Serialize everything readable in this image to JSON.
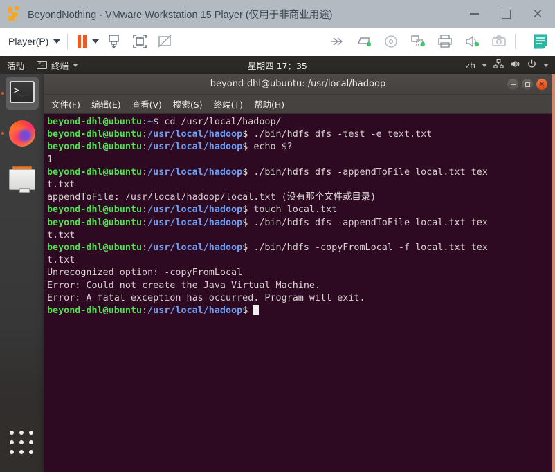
{
  "vmware": {
    "title": "BeyondNothing - VMware Workstation 15 Player (仅用于非商业用途)",
    "logo_icon": "vmware-logo-icon",
    "window_buttons": {
      "minimize": "minimize-icon",
      "maximize": "maximize-icon",
      "close": "close-icon"
    },
    "toolbar": {
      "player_menu_label": "Player(P)",
      "player_caret_icon": "chevron-down-icon",
      "pause_icon": "pause-icon",
      "pause_caret_icon": "chevron-down-icon",
      "unity_icon": "send-to-back-icon",
      "fullscreen_icon": "fullscreen-icon",
      "stretch_icon": "stretch-disabled-icon",
      "right_icons": [
        "network-fast-forward-icon",
        "removable-disk-icon",
        "cd-dvd-icon",
        "network-adapter-icon",
        "printer-icon",
        "sound-icon",
        "camera-icon",
        "notes-icon"
      ]
    }
  },
  "ubuntu_panel": {
    "activities": "活动",
    "app_name": "终端",
    "app_icon": "terminal-icon",
    "app_caret_icon": "chevron-down-icon",
    "clock": "星期四 17：35",
    "language": "zh",
    "language_caret_icon": "chevron-down-icon",
    "network_icon": "network-wired-icon",
    "volume_icon": "volume-icon",
    "power_icon": "power-icon",
    "system_caret_icon": "chevron-down-icon"
  },
  "dock": {
    "items": [
      {
        "name": "terminal",
        "icon": "terminal-icon",
        "running": true,
        "active": true
      },
      {
        "name": "firefox",
        "icon": "firefox-icon",
        "running": true,
        "active": false
      },
      {
        "name": "files",
        "icon": "file-manager-icon",
        "running": false,
        "active": false
      }
    ],
    "show_applications_icon": "apps-grid-icon"
  },
  "terminal": {
    "title": "beyond-dhl@ubuntu: /usr/local/hadoop",
    "window_buttons": {
      "minimize": "minimize-icon",
      "maximize": "maximize-icon",
      "close": "close-icon"
    },
    "menu": [
      "文件(F)",
      "编辑(E)",
      "查看(V)",
      "搜索(S)",
      "终端(T)",
      "帮助(H)"
    ],
    "colors": {
      "background": "#2d0922",
      "foreground": "#d7d2d0",
      "user_host": "#4ee24e",
      "path": "#6a9ef5",
      "window_accent": "#d98666",
      "close_button": "#dd4814"
    },
    "prompt": {
      "user_host": "beyond-dhl@ubuntu",
      "separator": ":",
      "dollar": "$ "
    },
    "lines": [
      {
        "type": "prompt",
        "path": "~",
        "command": "cd /usr/local/hadoop/"
      },
      {
        "type": "prompt",
        "path": "/usr/local/hadoop",
        "command": "./bin/hdfs dfs -test -e text.txt"
      },
      {
        "type": "prompt",
        "path": "/usr/local/hadoop",
        "command": "echo $?"
      },
      {
        "type": "output",
        "text": "1"
      },
      {
        "type": "prompt",
        "path": "/usr/local/hadoop",
        "command": "./bin/hdfs dfs -appendToFile local.txt tex"
      },
      {
        "type": "output",
        "text": "t.txt"
      },
      {
        "type": "output",
        "text": "appendToFile: /usr/local/hadoop/local.txt (没有那个文件或目录)"
      },
      {
        "type": "prompt",
        "path": "/usr/local/hadoop",
        "command": "touch local.txt"
      },
      {
        "type": "prompt",
        "path": "/usr/local/hadoop",
        "command": "./bin/hdfs dfs -appendToFile local.txt tex"
      },
      {
        "type": "output",
        "text": "t.txt"
      },
      {
        "type": "prompt",
        "path": "/usr/local/hadoop",
        "command": "./bin/hdfs -copyFromLocal -f local.txt tex"
      },
      {
        "type": "output",
        "text": "t.txt"
      },
      {
        "type": "output",
        "text": "Unrecognized option: -copyFromLocal"
      },
      {
        "type": "output",
        "text": "Error: Could not create the Java Virtual Machine."
      },
      {
        "type": "output",
        "text": "Error: A fatal exception has occurred. Program will exit."
      },
      {
        "type": "prompt",
        "path": "/usr/local/hadoop",
        "command": "",
        "cursor": true
      }
    ]
  }
}
